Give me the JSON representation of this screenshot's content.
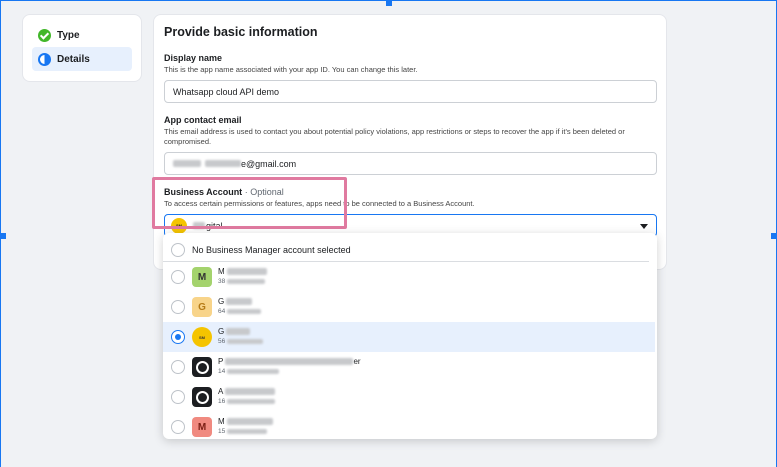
{
  "steps": [
    {
      "label": "Type",
      "state": "done",
      "icon": "check-circle-icon"
    },
    {
      "label": "Details",
      "state": "active",
      "icon": "half-circle-icon"
    }
  ],
  "form": {
    "title": "Provide basic information",
    "display_name": {
      "label": "Display name",
      "help": "This is the app name associated with your app ID. You can change this later.",
      "value": "Whatsapp cloud API demo"
    },
    "contact_email": {
      "label": "App contact email",
      "help": "This email address is used to contact you about potential policy violations, app restrictions or steps to recover the app if it's been deleted or compromised.",
      "value": "e@gmail.com"
    },
    "business_account": {
      "label": "Business Account",
      "optional": "· Optional",
      "help": "To access certain permissions or features, apps need to be connected to a Business Account.",
      "selected": "gital"
    }
  },
  "dropdown": {
    "none_label": "No Business Manager account selected",
    "options": [
      {
        "initial": "M",
        "name": "M",
        "sub": "38",
        "color": "#a4d36d",
        "kind": "letter"
      },
      {
        "initial": "G",
        "name": "G",
        "sub": "64",
        "color": "#f8d48a",
        "kind": "letter"
      },
      {
        "initial": "SM",
        "name": "G",
        "sub": "56",
        "color": "#f5c400",
        "kind": "round",
        "selected": true
      },
      {
        "initial": "",
        "name": "P",
        "suffix": "er",
        "sub": "14",
        "color": "#1c1e21",
        "kind": "meta"
      },
      {
        "initial": "",
        "name": "A",
        "sub": "16",
        "color": "#1c1e21",
        "kind": "meta"
      },
      {
        "initial": "M",
        "name": "M",
        "sub": "15",
        "color": "#f08a80",
        "kind": "letter"
      }
    ]
  },
  "colors": {
    "accent": "#1877f2",
    "highlight": "#e07aa0",
    "success": "#42b72a"
  }
}
